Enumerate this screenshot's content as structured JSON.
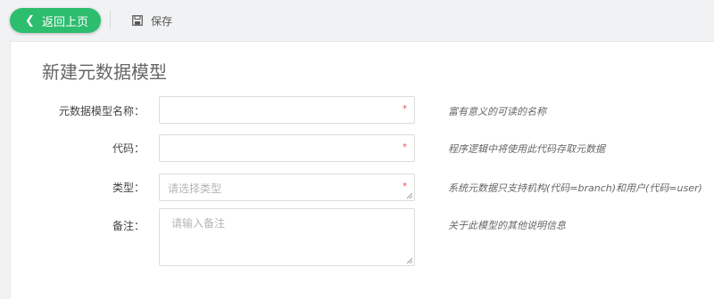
{
  "toolbar": {
    "back_label": "返回上页",
    "save_label": "保存"
  },
  "page": {
    "title": "新建元数据模型"
  },
  "form": {
    "fields": [
      {
        "label": "元数据模型名称：",
        "value": "",
        "placeholder": "",
        "required_mark": "*",
        "hint": "富有意义的可读的名称"
      },
      {
        "label": "代码：",
        "value": "",
        "placeholder": "",
        "required_mark": "*",
        "hint": "程序逻辑中将使用此代码存取元数据"
      },
      {
        "label": "类型：",
        "value": "",
        "placeholder": "请选择类型",
        "required_mark": "*",
        "hint": "系统元数据只支持机构(代码=branch)和用户(代码=user)"
      },
      {
        "label": "备注：",
        "value": "",
        "placeholder": "请输入备注",
        "required_mark": "",
        "hint": "关于此模型的其他说明信息"
      }
    ]
  },
  "colors": {
    "accent": "#2dbd6e",
    "required": "#e05555"
  },
  "icons": {
    "back": "chevron-left-icon",
    "save": "save-icon"
  }
}
